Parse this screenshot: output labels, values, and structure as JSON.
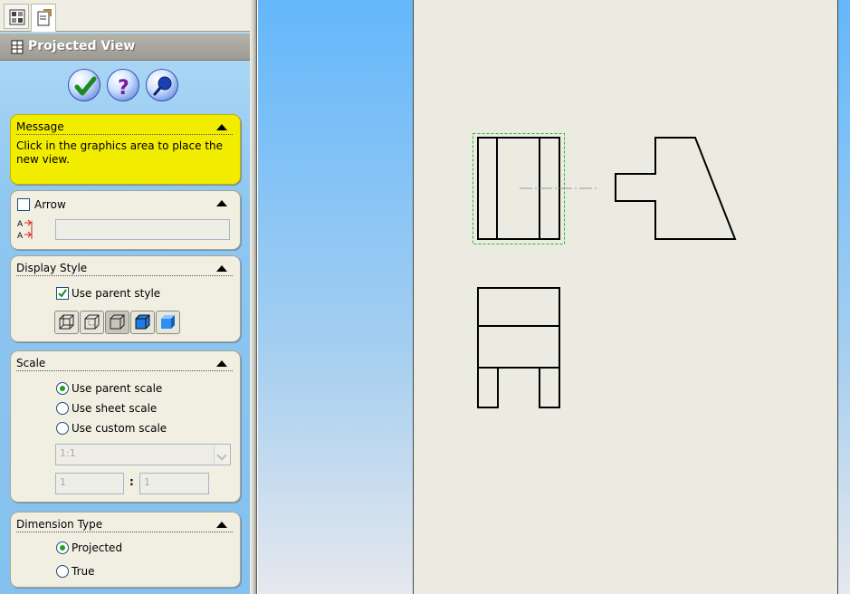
{
  "panel": {
    "title": "Projected View",
    "tabs": [
      "feature-manager-tab-icon",
      "property-manager-tab-icon"
    ],
    "actions": [
      {
        "name": "ok",
        "icon": "green-check-icon"
      },
      {
        "name": "help",
        "icon": "question-mark-icon"
      },
      {
        "name": "detailed-preview",
        "icon": "pushpin-icon"
      }
    ]
  },
  "message": {
    "title": "Message",
    "text": "Click in the graphics area to place the new view."
  },
  "arrow": {
    "label": "Arrow",
    "checked": false,
    "value": ""
  },
  "display_style": {
    "title": "Display Style",
    "use_parent_label": "Use parent style",
    "use_parent_checked": true,
    "modes": [
      "wireframe",
      "hidden-lines-visible",
      "hidden-lines-removed",
      "shaded-with-edges",
      "shaded"
    ],
    "selected_mode": "hidden-lines-removed"
  },
  "scale": {
    "title": "Scale",
    "options": [
      "Use parent scale",
      "Use sheet scale",
      "Use custom scale"
    ],
    "selected": "Use parent scale",
    "custom_value": "1:1",
    "numerator": "1",
    "separator": ":",
    "denominator": "1"
  },
  "dimension_type": {
    "title": "Dimension Type",
    "options": [
      "Projected",
      "True"
    ],
    "selected": "Projected"
  },
  "colors": {
    "message_bg": "#f2ec00",
    "panel_bg": "#84c1ee",
    "sheet_bg": "#ecebe1",
    "selection_dash": "#22bb22"
  }
}
